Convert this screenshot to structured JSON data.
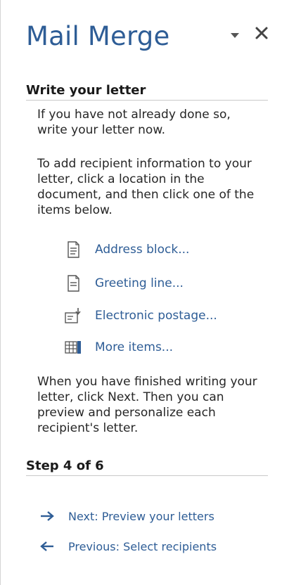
{
  "pane": {
    "title": "Mail Merge",
    "menu_icon": "dropdown-triangle-icon",
    "close_icon": "close-icon"
  },
  "write_section": {
    "heading": "Write your letter",
    "para1": "If you have not already done so, write your letter now.",
    "para2": "To add recipient information to your letter, click a location in the document, and then click one of the items below.",
    "items": [
      {
        "label": "Address block...",
        "icon": "address-block-icon"
      },
      {
        "label": "Greeting line...",
        "icon": "greeting-line-icon"
      },
      {
        "label": "Electronic postage...",
        "icon": "electronic-postage-icon"
      },
      {
        "label": "More items...",
        "icon": "more-items-icon"
      }
    ],
    "para3": "When you have finished writing your letter, click Next. Then you can preview and personalize each recipient's letter."
  },
  "step_section": {
    "heading": "Step 4 of 6",
    "next_label": "Next: Preview your letters",
    "previous_label": "Previous: Select recipients"
  },
  "colors": {
    "title": "#2e5d96",
    "link": "#2e5d96",
    "text": "#262626",
    "rule": "#c9c9c9"
  }
}
